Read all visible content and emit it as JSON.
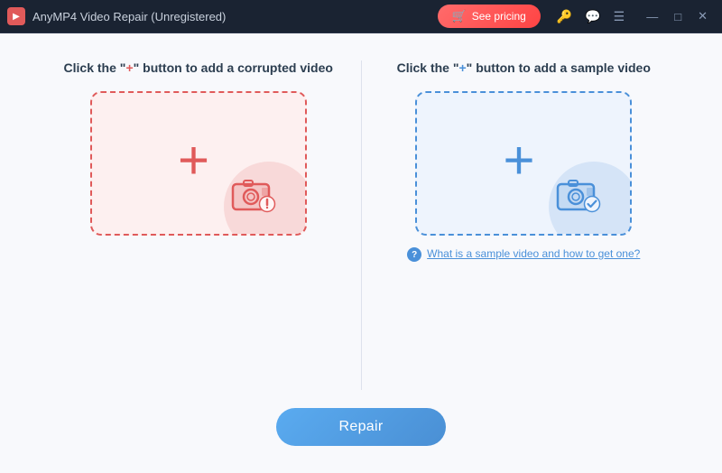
{
  "titlebar": {
    "app_icon_label": "▶",
    "title": "AnyMP4 Video Repair (Unregistered)",
    "see_pricing_label": "See pricing",
    "cart_icon": "🛒",
    "key_icon": "🔑",
    "chat_icon": "💬",
    "menu_icon": "☰",
    "minimize_icon": "—",
    "maximize_icon": "□",
    "close_icon": "✕"
  },
  "left_panel": {
    "title_prefix": "Click the ",
    "plus_char": "+",
    "title_suffix": "\" button to add a corrupted video",
    "add_label": "+"
  },
  "right_panel": {
    "title_prefix": "Click the ",
    "plus_char": "+",
    "title_suffix": "\" button to add a sample video",
    "add_label": "+",
    "help_link_text": "What is a sample video and how to get one?"
  },
  "repair_btn": {
    "label": "Repair"
  },
  "colors": {
    "red_accent": "#e05a5a",
    "blue_accent": "#4a90d9"
  }
}
